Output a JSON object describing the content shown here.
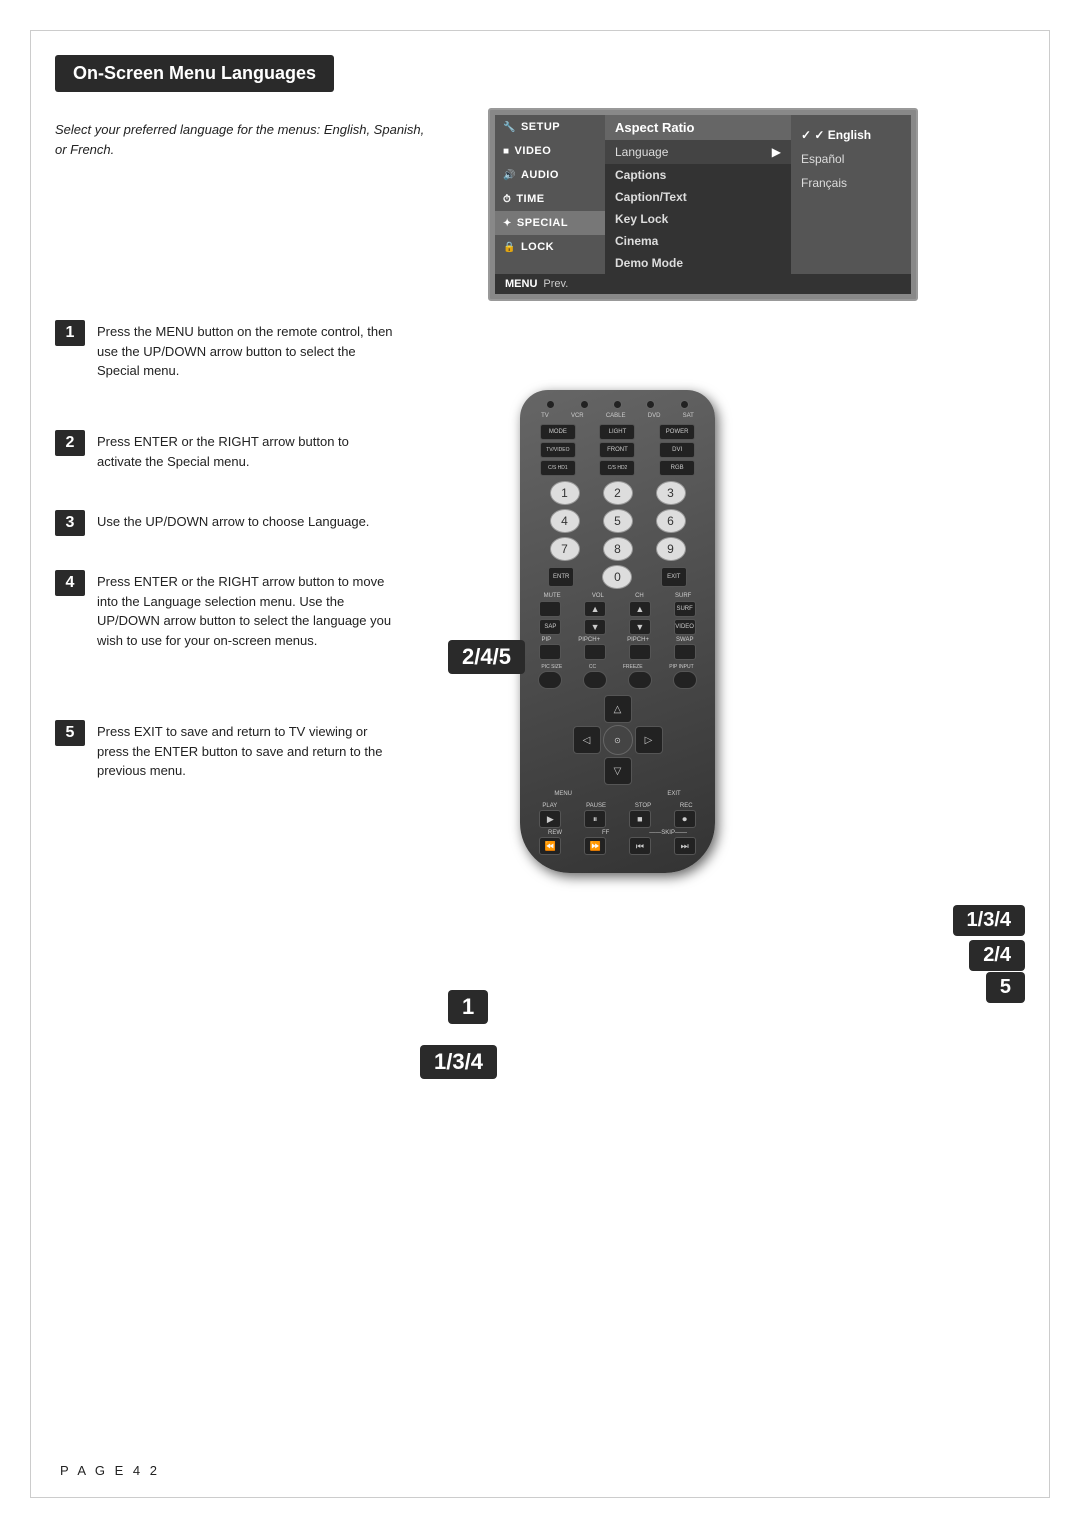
{
  "page": {
    "title": "On-Screen Menu Languages",
    "intro": "Select your preferred language for the menus: English, Spanish, or French.",
    "page_num": "P A G E   4 2"
  },
  "tv_menu": {
    "sidebar": [
      {
        "label": "SETUP",
        "icon": "🔧",
        "active": false
      },
      {
        "label": "VIDEO",
        "icon": "■",
        "active": false
      },
      {
        "label": "AUDIO",
        "icon": "♪",
        "active": false
      },
      {
        "label": "TIME",
        "icon": "⏱",
        "active": false
      },
      {
        "label": "SPECIAL",
        "icon": "✦",
        "active": true
      },
      {
        "label": "LOCK",
        "icon": "🔒",
        "active": false
      }
    ],
    "menu_items": [
      {
        "label": "Aspect Ratio",
        "highlighted": true
      },
      {
        "label": "Language",
        "has_arrow": true,
        "selected": true
      },
      {
        "label": "Captions",
        "highlighted": false
      },
      {
        "label": "Caption/Text",
        "highlighted": false
      },
      {
        "label": "Key Lock",
        "highlighted": false
      },
      {
        "label": "Cinema",
        "highlighted": false
      },
      {
        "label": "Demo Mode",
        "highlighted": false
      }
    ],
    "submenu": [
      {
        "label": "English",
        "checked": true
      },
      {
        "label": "Español",
        "checked": false
      },
      {
        "label": "Français",
        "checked": false
      }
    ],
    "footer": {
      "menu_label": "MENU",
      "prev_label": "Prev."
    }
  },
  "steps": [
    {
      "num": "1",
      "text": "Press the MENU button on the remote control, then use the UP/DOWN arrow button to select the Special menu."
    },
    {
      "num": "2",
      "text": "Press ENTER or the RIGHT arrow button to activate the Special menu."
    },
    {
      "num": "3",
      "text": "Use the UP/DOWN arrow to choose Language."
    },
    {
      "num": "4",
      "text": "Press ENTER or the RIGHT arrow button to move into the Language selection menu. Use the UP/DOWN arrow button to select the language you wish to use for your on-screen menus."
    },
    {
      "num": "5",
      "text": "Press EXIT to save and return to TV viewing or press the ENTER button to save and return to the previous menu."
    }
  ],
  "callouts": {
    "badge_245": "2/4/5",
    "badge_134_right": "1/3/4",
    "badge_24_right": "2/4",
    "badge_5_right": "5",
    "badge_1": "1",
    "badge_134_bottom": "1/3/4"
  },
  "remote": {
    "top_labels": [
      "TV",
      "VCR",
      "CABLE",
      "DVD",
      "SAT"
    ],
    "row1_labels": [
      "MODE",
      "LIGHT",
      "POWER"
    ],
    "row2_labels": [
      "TV/VIDEO",
      "FRONT",
      "DVI"
    ],
    "row3_labels": [
      "C/S HD1",
      "C/S HD2",
      "RGB"
    ],
    "numbers": [
      "1",
      "2",
      "3",
      "4",
      "5",
      "6",
      "7",
      "8",
      "9",
      "0"
    ],
    "ctrl_labels": [
      "MUTE",
      "VOL",
      "CH",
      "SURF"
    ],
    "extra_labels": [
      "SAP",
      "",
      "",
      "VIDEO"
    ],
    "arrow_labels": [
      "MENU",
      "EXIT"
    ],
    "play_labels": [
      "PLAY",
      "PAUSE",
      "STOP",
      "REC"
    ],
    "transport_labels": [
      "REW",
      "FF",
      "",
      "SKIP"
    ]
  }
}
